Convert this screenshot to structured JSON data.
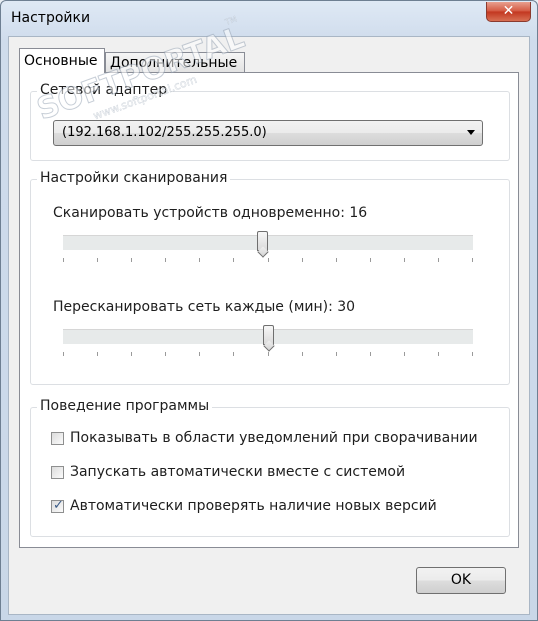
{
  "window": {
    "title": "Настройки",
    "close_label": "✕"
  },
  "tabs": [
    {
      "label": "Основные",
      "active": true
    },
    {
      "label": "Дополнительные",
      "active": false
    }
  ],
  "network": {
    "group_label": "Сетевой адаптер",
    "adapter_value": "(192.168.1.102/255.255.255.0)"
  },
  "scan": {
    "group_label": "Настройки сканирования",
    "concurrent_label": "Сканировать устройств одновременно: 16",
    "concurrent_position": 0.485,
    "rescan_label": "Пересканировать сеть каждые (мин): 30",
    "rescan_position": 0.5
  },
  "behavior": {
    "group_label": "Поведение программы",
    "options": [
      {
        "label": "Показывать в области уведомлений при сворачивании",
        "checked": false
      },
      {
        "label": "Запускать автоматически вместе с системой",
        "checked": false
      },
      {
        "label": "Автоматически проверять наличие новых версий",
        "checked": true
      }
    ]
  },
  "footer": {
    "ok_label": "OK"
  },
  "watermark": {
    "brand": "SOFTPORTAL",
    "url": "www.softportal.com",
    "tm": "TM"
  },
  "colors": {
    "title_bar": "#cfdcec",
    "close_button": "#c2361f",
    "panel_background": "#ffffff",
    "check_mark": "#3a5b87"
  }
}
